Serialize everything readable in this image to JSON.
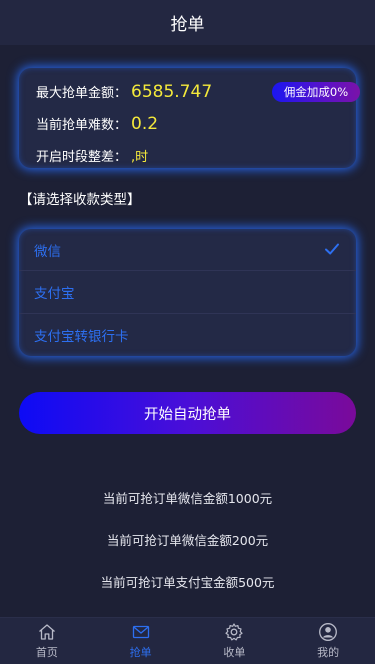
{
  "header": {
    "title": "抢单"
  },
  "info": {
    "max_amount_label": "最大抢单金额：",
    "max_amount_value": "6585.747",
    "difficulty_label": "当前抢单难数：",
    "difficulty_value": "0.2",
    "interval_label": "开启时段整差：",
    "interval_value": ",时",
    "commission_badge": "佣金加成0%"
  },
  "payment": {
    "section_title": "【请选择收款类型】",
    "options": [
      {
        "label": "微信",
        "selected": true
      },
      {
        "label": "支付宝",
        "selected": false
      },
      {
        "label": "支付宝转银行卡",
        "selected": false
      }
    ]
  },
  "start_button": {
    "label": "开始自动抢单"
  },
  "available": [
    "当前可抢订单微信金额1000元",
    "当前可抢订单微信金额200元",
    "当前可抢订单支付宝金额500元"
  ],
  "tabbar": {
    "items": [
      {
        "label": "首页",
        "icon": "home-icon"
      },
      {
        "label": "抢单",
        "icon": "mail-icon"
      },
      {
        "label": "收单",
        "icon": "gear-icon"
      },
      {
        "label": "我的",
        "icon": "user-icon"
      }
    ],
    "active_index": 1
  },
  "colors": {
    "accent_blue": "#2d6ff0",
    "value_yellow": "#f4e93b",
    "background": "#1d2035"
  }
}
